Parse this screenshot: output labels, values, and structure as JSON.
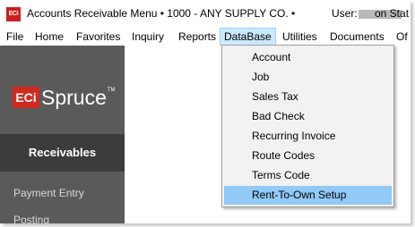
{
  "window": {
    "icon_text": "ECi",
    "title": "Accounts Receivable Menu  •  1000 - ANY SUPPLY CO.  •",
    "user_label": "User:",
    "title_tail": "on Stat"
  },
  "menubar": {
    "items": [
      "File",
      "Home",
      "Favorites",
      "Inquiry",
      "Reports",
      "DataBase",
      "Utilities",
      "Documents",
      "Of"
    ]
  },
  "sidebar": {
    "logo_eci": "ECi",
    "logo_spruce": "Spruce",
    "logo_tm": "TM",
    "section": "Receivables",
    "links": [
      "Payment Entry",
      "Posting"
    ]
  },
  "dropdown": {
    "items": [
      "Account",
      "Job",
      "Sales Tax",
      "Bad Check",
      "Recurring Invoice",
      "Route Codes",
      "Terms Code",
      "Rent-To-Own Setup"
    ],
    "highlighted": "Rent-To-Own Setup"
  },
  "colors": {
    "sidebar_bg": "#5a5a5a",
    "section_bg": "#3c3c3c",
    "brand_red": "#d02a1f",
    "menu_active": "#cce8ff",
    "dropdown_highlight": "#91c9f7"
  }
}
